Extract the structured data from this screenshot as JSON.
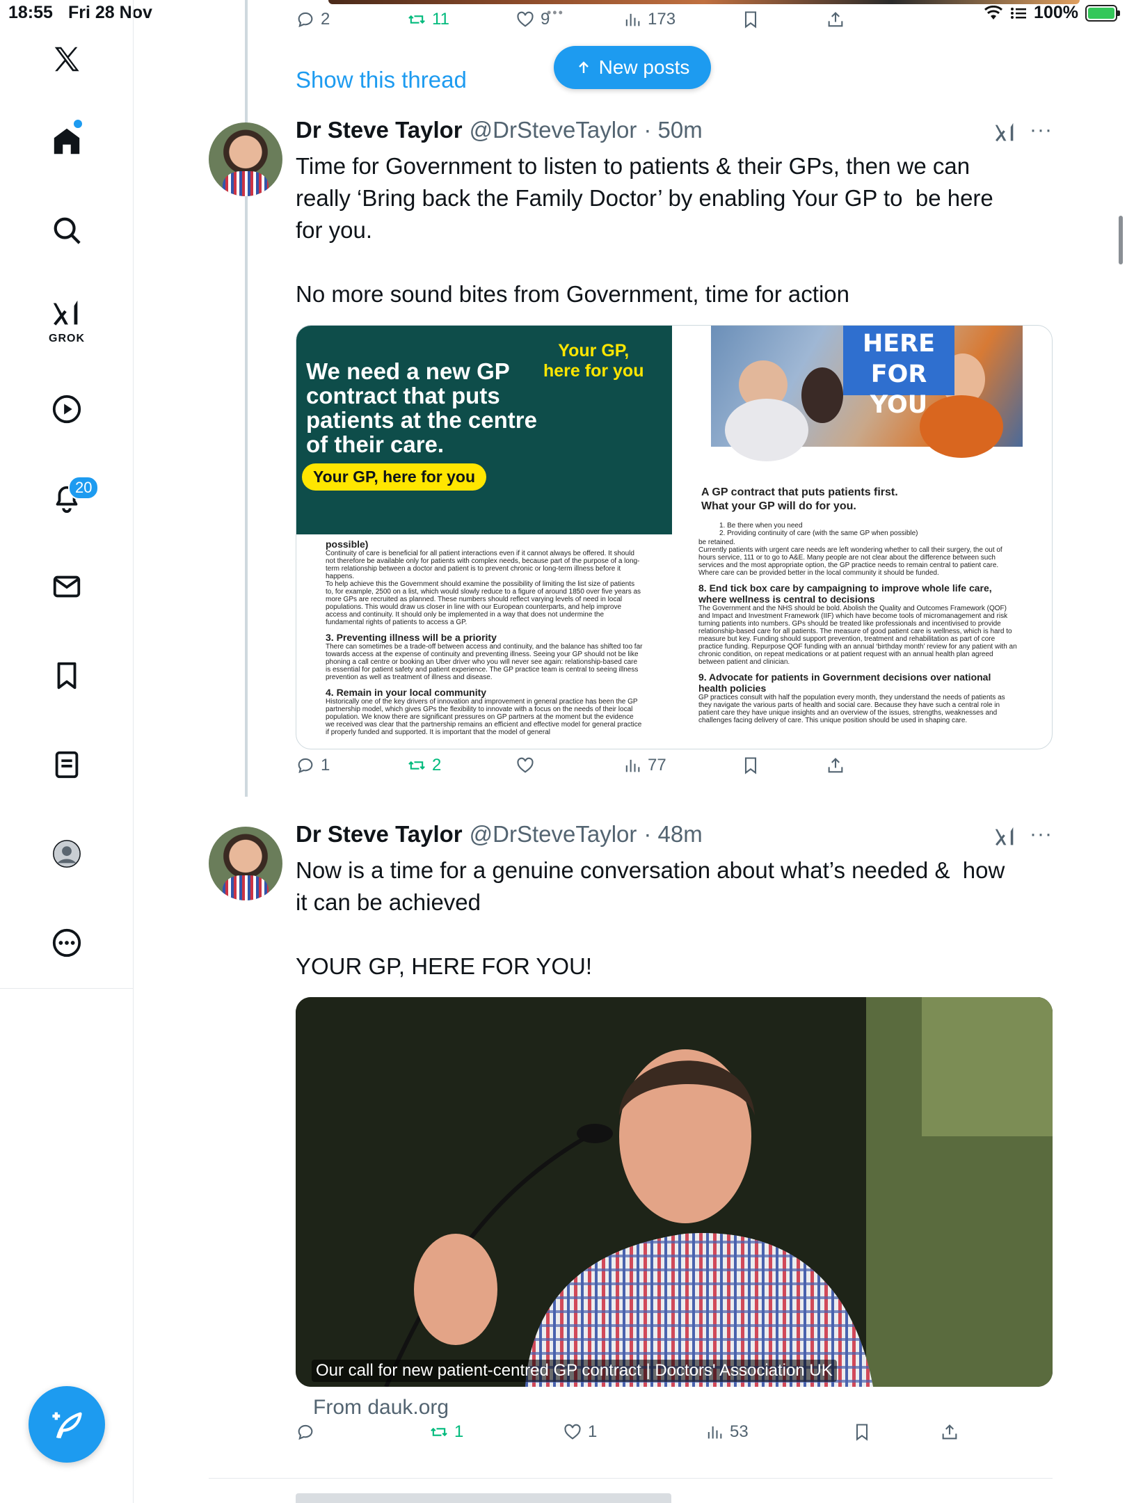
{
  "status_bar": {
    "time": "18:55",
    "date": "Fri 28 Nov",
    "battery": "100%",
    "multitask_dots": "•••"
  },
  "sidebar": {
    "grok_label": "GROK",
    "notifications_count": "20",
    "icons": [
      "x-logo-icon",
      "home-icon",
      "search-icon",
      "grok-icon",
      "video-icon",
      "notifications-icon",
      "messages-icon",
      "bookmarks-icon",
      "lists-icon",
      "profile-icon",
      "more-icon"
    ]
  },
  "previous_post_actions": {
    "replies": "2",
    "reposts": "11",
    "likes": "9",
    "views": "173"
  },
  "show_thread": "Show this thread",
  "new_posts": "New posts",
  "posts": [
    {
      "name": "Dr Steve Taylor",
      "handle": "@DrSteveTaylor",
      "time": "· 50m",
      "text": "Time for Government to listen to patients & their GPs, then we can\nreally ‘Bring back the Family Doctor’ by enabling Your GP to  be here\nfor you.\n\nNo more sound bites from Government, time for action",
      "actions": {
        "replies": "1",
        "reposts": "2",
        "likes": "",
        "views": "77"
      },
      "media": {
        "banner_yellow": "Your GP,\nhere for you",
        "banner_title": "We need a new GP contract that puts patients at the centre of their care.",
        "banner_pill": "Your GP, here for you",
        "here_for_you": "HERE\nFOR YOU",
        "right_heading": "A GP contract that puts patients first.\nWhat your GP will do for you.",
        "right_list_1": "1.      Be there when you need",
        "right_list_2": "2.      Providing continuity of care (with the same GP when possible)",
        "left_h_possible": "possible)",
        "left_p1": "Continuity of care is beneficial for all patient interactions even if it cannot always be offered. It should not therefore be available only for patients with complex needs, because part of the purpose of a long-term relationship between a doctor and patient is to prevent chronic or long-term illness before it happens.",
        "left_p2": "To help achieve this the Government should examine the possibility of limiting the list size of patients to, for example, 2500 on a list, which would slowly reduce to a figure of around 1850 over five years as more GPs are recruited as planned. These numbers should reflect varying levels of need in local populations. This would draw us closer in line with our European counterparts, and help improve access and continuity. It should only be implemented in a way that does not undermine the fundamental rights of patients to access a GP.",
        "left_h3": "3. Preventing illness will be a priority",
        "left_p3": "There can sometimes be a trade-off between access and continuity, and the balance has shifted too far towards access at the expense of continuity and preventing illness. Seeing your GP should not be like phoning a call centre or booking an Uber driver who you will never see again: relationship-based care is essential for patient safety and patient experience. The GP practice team is central to seeing illness prevention as well as treatment of illness and disease.",
        "left_h4": "4. Remain in your local community",
        "left_p4": "Historically one of the key drivers of innovation and improvement in general practice has been the GP partnership model, which gives GPs the flexibility to innovate with a focus on the needs of their local population. We know there are significant pressures on GP partners at the moment but the evidence we received was clear that the partnership remains an efficient and effective model for general practice if properly funded and supported. It is important that the model of general",
        "right_p_retained": "be retained.",
        "right_p1": "Currently patients with urgent care needs are left wondering whether to call their surgery, the out of hours service, 111 or to go to A&E. Many people are not clear about the difference between such services and the most appropriate option, the GP practice needs to remain central to patient care.",
        "right_p1b": "Where care can be provided better in the local community it should be funded.",
        "right_h8": "8. End tick box care by campaigning to improve whole life care, where wellness is central to decisions",
        "right_p8": "The Government and the NHS should be bold. Abolish the Quality and Outcomes Framework (QOF) and Impact and Investment Framework (IIF) which have become tools of micromanagement and risk turning patients into numbers. GPs should be treated like professionals and incentivised to provide relationship-based care for all patients. The measure of good patient care is wellness, which is hard to measure but key. Funding should support prevention, treatment and rehabilitation as part of core practice funding. Repurpose QOF funding with an annual ‘birthday month’ review for any patient with an chronic condition, on repeat medications or at patient request with an annual health plan agreed between patient and clinician.",
        "right_h9": "9. Advocate for patients in Government decisions over national health policies",
        "right_p9": "GP practices consult with half the population every month, they understand the needs of patients as they navigate the various parts of health and social care. Because they have such a central role in patient care they have unique insights and an overview of the issues, strengths, weaknesses and challenges facing delivery of care. This unique position should be used in shaping care."
      }
    },
    {
      "name": "Dr Steve Taylor",
      "handle": "@DrSteveTaylor",
      "time": "· 48m",
      "text": "Now is a time for a genuine conversation about what’s needed &  how\nit can be achieved\n\nYOUR GP, HERE FOR YOU!",
      "link_caption": "Our call for new patient-centred GP contract | Doctors' Association UK",
      "link_domain": "From dauk.org",
      "actions": {
        "replies": "",
        "reposts": "1",
        "likes": "1",
        "views": "53"
      }
    }
  ],
  "colors": {
    "accent": "#1d9bf0",
    "repost": "#00ba7c",
    "banner": "#0e4d4a",
    "banner_yellow": "#ffe600"
  }
}
